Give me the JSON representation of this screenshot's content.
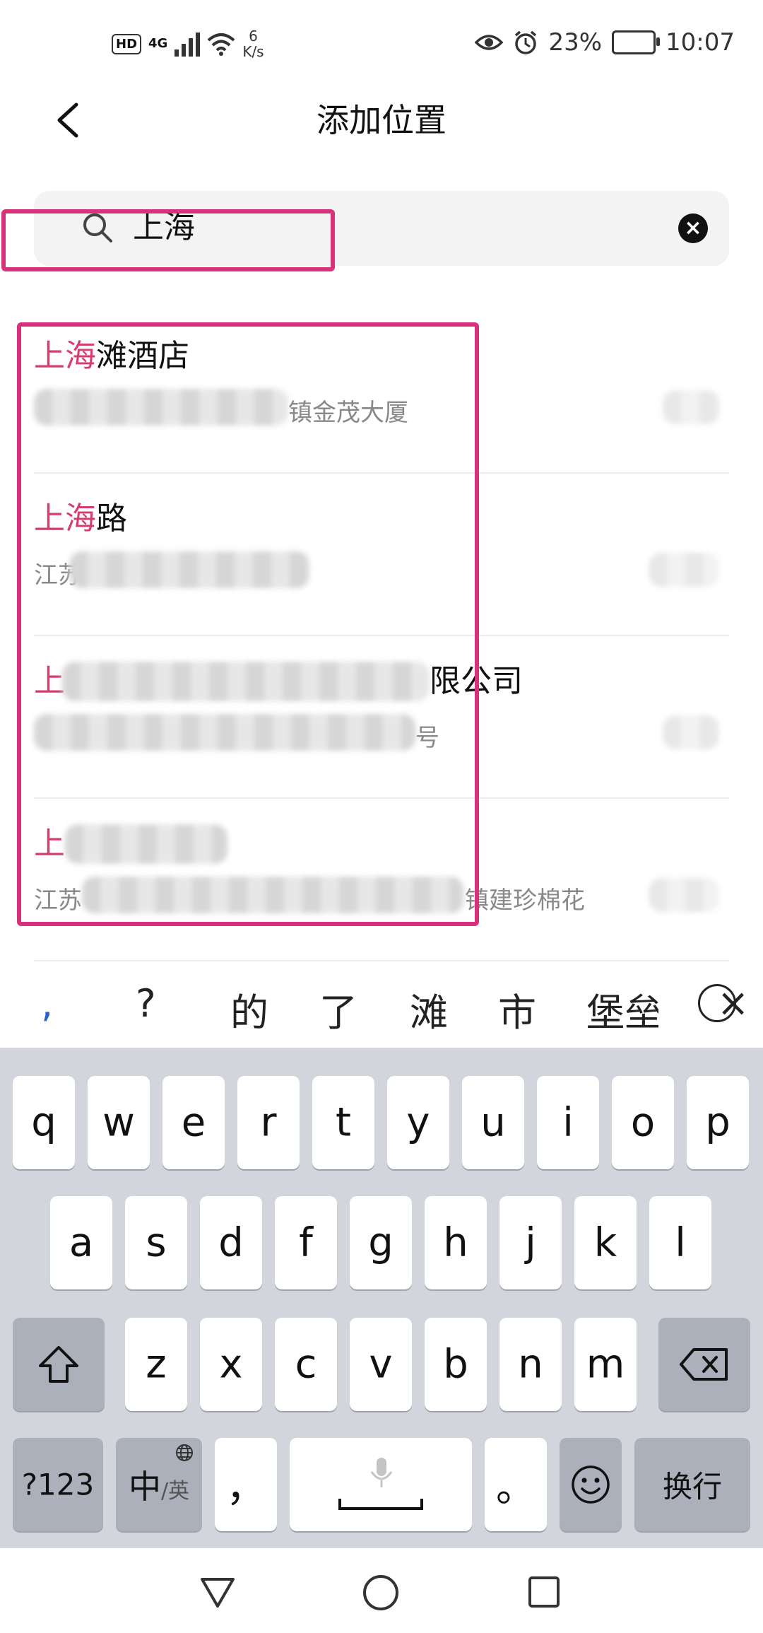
{
  "status_bar": {
    "hd": "HD",
    "network": "4G",
    "speed_value": "6",
    "speed_unit": "K/s",
    "battery": "23%",
    "time": "10:07"
  },
  "header": {
    "title": "添加位置"
  },
  "search": {
    "query": "上海"
  },
  "results": [
    {
      "title_highlight": "上海",
      "title_rest": "滩酒店",
      "subtitle": "镇金茂大厦"
    },
    {
      "title_highlight": "上海",
      "title_rest": "路",
      "subtitle": "江苏"
    },
    {
      "title_highlight": "上",
      "title_rest": "限公司",
      "subtitle": "号"
    },
    {
      "title_highlight": "上",
      "title_rest": "",
      "subtitle": "江苏",
      "subtitle_tail": "镇建珍棉花"
    }
  ],
  "candidates": [
    ",",
    "?",
    "的",
    "了",
    "滩",
    "市",
    "堡垒"
  ],
  "keyboard": {
    "row1": [
      "q",
      "w",
      "e",
      "r",
      "t",
      "y",
      "u",
      "i",
      "o",
      "p"
    ],
    "row2": [
      "a",
      "s",
      "d",
      "f",
      "g",
      "h",
      "j",
      "k",
      "l"
    ],
    "row3": [
      "z",
      "x",
      "c",
      "v",
      "b",
      "n",
      "m"
    ],
    "num_key": "?123",
    "lang_key_main": "中",
    "lang_key_sub": "/英",
    "comma_key": "，",
    "period_key": "。",
    "enter_key": "换行"
  }
}
